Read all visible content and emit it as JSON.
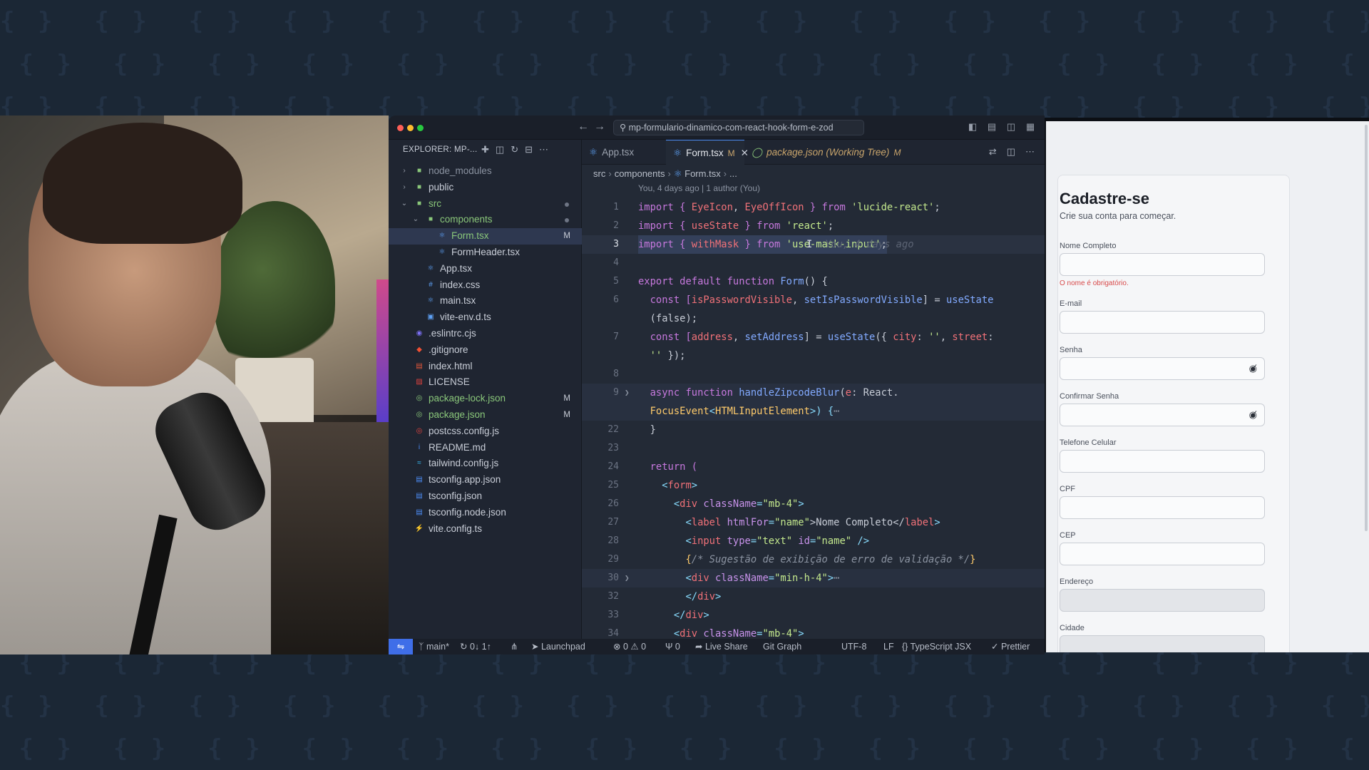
{
  "window": {
    "search_text": "mp-formulario-dinamico-com-react-hook-form-e-zod"
  },
  "explorer": {
    "title": "EXPLORER: MP-...",
    "items": [
      {
        "label": "node_modules",
        "kind": "folder",
        "expanded": false,
        "icon": "folder-icon"
      },
      {
        "label": "public",
        "kind": "folder",
        "expanded": false,
        "icon": "folder-icon"
      },
      {
        "label": "src",
        "kind": "folder",
        "expanded": true,
        "icon": "folder-icon"
      },
      {
        "label": "components",
        "kind": "folder",
        "expanded": true,
        "icon": "folder-icon"
      },
      {
        "label": "Form.tsx",
        "kind": "file",
        "badge": "M",
        "icon": "react-icon"
      },
      {
        "label": "FormHeader.tsx",
        "kind": "file",
        "icon": "react-icon"
      },
      {
        "label": "App.tsx",
        "kind": "file",
        "icon": "react-icon"
      },
      {
        "label": "index.css",
        "kind": "file",
        "icon": "css-icon"
      },
      {
        "label": "main.tsx",
        "kind": "file",
        "icon": "react-icon"
      },
      {
        "label": "vite-env.d.ts",
        "kind": "file",
        "icon": "ts-icon"
      },
      {
        "label": ".eslintrc.cjs",
        "kind": "file",
        "icon": "eslint-icon"
      },
      {
        "label": ".gitignore",
        "kind": "file",
        "icon": "git-icon"
      },
      {
        "label": "index.html",
        "kind": "file",
        "icon": "html-icon"
      },
      {
        "label": "LICENSE",
        "kind": "file",
        "icon": "license-icon"
      },
      {
        "label": "package-lock.json",
        "kind": "file",
        "badge": "M",
        "icon": "npm-icon"
      },
      {
        "label": "package.json",
        "kind": "file",
        "badge": "M",
        "icon": "npm-icon"
      },
      {
        "label": "postcss.config.js",
        "kind": "file",
        "icon": "postcss-icon"
      },
      {
        "label": "README.md",
        "kind": "file",
        "icon": "info-icon"
      },
      {
        "label": "tailwind.config.js",
        "kind": "file",
        "icon": "tailwind-icon"
      },
      {
        "label": "tsconfig.app.json",
        "kind": "file",
        "icon": "tsconfig-icon"
      },
      {
        "label": "tsconfig.json",
        "kind": "file",
        "icon": "tsconfig-icon"
      },
      {
        "label": "tsconfig.node.json",
        "kind": "file",
        "icon": "tsconfig-icon"
      },
      {
        "label": "vite.config.ts",
        "kind": "file",
        "icon": "vite-icon"
      }
    ]
  },
  "tabs": [
    {
      "label": "App.tsx"
    },
    {
      "label": "Form.tsx",
      "modified": "M",
      "active": true
    },
    {
      "label": "package.json (Working Tree)",
      "modified": "M"
    }
  ],
  "breadcrumb": [
    "src",
    "components",
    "Form.tsx",
    "..."
  ],
  "blame": "You, 4 days ago | 1 author (You)",
  "code_lines": [
    {
      "n": "1"
    },
    {
      "n": "2"
    },
    {
      "n": "3"
    },
    {
      "n": "4"
    },
    {
      "n": "5"
    },
    {
      "n": "6"
    },
    {
      "n": ""
    },
    {
      "n": "7"
    },
    {
      "n": ""
    },
    {
      "n": "8"
    },
    {
      "n": "9"
    },
    {
      "n": ""
    },
    {
      "n": "22"
    },
    {
      "n": "23"
    },
    {
      "n": "24"
    },
    {
      "n": "25"
    },
    {
      "n": "26"
    },
    {
      "n": "27"
    },
    {
      "n": "28"
    },
    {
      "n": "29"
    },
    {
      "n": "30"
    },
    {
      "n": "32"
    },
    {
      "n": "33"
    },
    {
      "n": "34"
    }
  ],
  "code": {
    "l1_a": "import { ",
    "l1_b": "EyeIcon",
    "l1_c": ", ",
    "l1_d": "EyeOffIcon",
    "l1_e": " } from ",
    "l1_f": "'lucide-react'",
    "l1_g": ";",
    "l2_a": "import { ",
    "l2_b": "useState",
    "l2_c": " } from ",
    "l2_d": "'react'",
    "l2_e": ";",
    "l3_a": "import { ",
    "l3_b": "withMask",
    "l3_c": " } from ",
    "l3_d": "'use-mask-input'",
    "l3_e": ";",
    "l3_ghost": "You, 4 days ago",
    "l5_a": "export default function ",
    "l5_b": "Form",
    "l5_c": "() {",
    "l6_a": "  const [",
    "l6_b": "isPasswordVisible",
    "l6_c": ", ",
    "l6_d": "setIsPasswordVisible",
    "l6_e": "] = ",
    "l6_f": "useState",
    "l6b": "  (false);",
    "l7_a": "  const [",
    "l7_b": "address",
    "l7_c": ", ",
    "l7_d": "setAddress",
    "l7_e": "] = ",
    "l7_f": "useState",
    "l7_g": "({ ",
    "l7_h": "city",
    "l7_i": ": ",
    "l7_j": "''",
    "l7_k": ", ",
    "l7_l": "street",
    "l7_m": ":",
    "l7b_a": "  ",
    "l7b_b": "''",
    "l7b_c": " });",
    "l9_a": "  async function ",
    "l9_b": "handleZipcodeBlur",
    "l9_c": "(",
    "l9_d": "e",
    "l9_e": ": React.",
    "l9b_a": "  ",
    "l9b_b": "FocusEvent",
    "l9b_c": "<",
    "l9b_d": "HTMLInputElement",
    "l9b_e": ">) {",
    "l9b_f": "⋯",
    "l22": "  }",
    "l24": "  return (",
    "l25_a": "    <",
    "l25_b": "form",
    "l25_c": ">",
    "l26_a": "      <",
    "l26_b": "div",
    "l26_c": " className",
    "l26_d": "=",
    "l26_e": "\"mb-4\"",
    "l26_f": ">",
    "l27_a": "        <",
    "l27_b": "label",
    "l27_c": " htmlFor",
    "l27_d": "=",
    "l27_e": "\"name\"",
    "l27_f": ">Nome Completo</",
    "l27_g": "label",
    "l27_h": ">",
    "l28_a": "        <",
    "l28_b": "input",
    "l28_c": " type",
    "l28_d": "=",
    "l28_e": "\"text\"",
    "l28_f": " id",
    "l28_g": "=",
    "l28_h": "\"name\"",
    "l28_i": " />",
    "l29_a": "        {",
    "l29_b": "/* Sugestão de exibição de erro de validação */",
    "l29_c": "}",
    "l30_a": "        <",
    "l30_b": "div",
    "l30_c": " className",
    "l30_d": "=",
    "l30_e": "\"min-h-4\"",
    "l30_f": ">",
    "l30_g": "⋯",
    "l32_a": "        </",
    "l32_b": "div",
    "l32_c": ">",
    "l33_a": "      </",
    "l33_b": "div",
    "l33_c": ">",
    "l34_a": "      <",
    "l34_b": "div",
    "l34_c": " className",
    "l34_d": "=",
    "l34_e": "\"mb-4\"",
    "l34_f": ">"
  },
  "statusbar": {
    "branch": "main*",
    "sync": "0↓ 1↑",
    "launchpad": "Launchpad",
    "errors": "0",
    "warnings": "0",
    "ports": "0",
    "live_share": "Live Share",
    "git_graph": "Git Graph",
    "encoding": "UTF-8",
    "eol": "LF",
    "language": "TypeScript JSX",
    "prettier": "Prettier"
  },
  "form": {
    "title": "Cadastre-se",
    "subtitle": "Crie sua conta para começar.",
    "fields": [
      {
        "label": "Nome Completo",
        "error": "O nome é obrigatório."
      },
      {
        "label": "E-mail"
      },
      {
        "label": "Senha",
        "icon": "eye-off-icon"
      },
      {
        "label": "Confirmar Senha",
        "icon": "eye-off-icon"
      },
      {
        "label": "Telefone Celular"
      },
      {
        "label": "CPF"
      },
      {
        "label": "CEP"
      },
      {
        "label": "Endereço",
        "disabled": true
      },
      {
        "label": "Cidade",
        "disabled": true
      }
    ]
  }
}
